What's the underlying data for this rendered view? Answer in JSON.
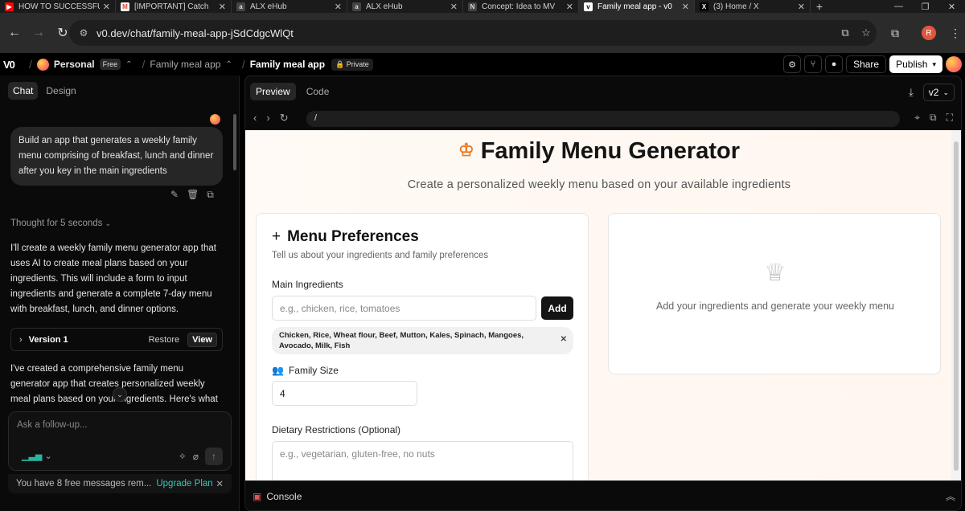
{
  "browser": {
    "tabs": [
      {
        "label": "HOW TO SUCCESSFU",
        "icon": "youtube-icon",
        "color": "#ff0000",
        "active": false
      },
      {
        "label": "[IMPORTANT] Catch",
        "icon": "gmail-icon",
        "color": "#ea4335",
        "active": false
      },
      {
        "label": "ALX eHub",
        "icon": "alx-icon",
        "color": "#555555",
        "active": false
      },
      {
        "label": "ALX eHub",
        "icon": "alx-icon",
        "color": "#555555",
        "active": false
      },
      {
        "label": "Concept: Idea to MV",
        "icon": "notion-icon",
        "color": "#555555",
        "active": false
      },
      {
        "label": "Family meal app - v0",
        "icon": "v0-icon",
        "color": "#ffffff",
        "active": true
      },
      {
        "label": "(3) Home / X",
        "icon": "x-icon",
        "color": "#ffffff",
        "active": false
      }
    ],
    "url": "v0.dev/chat/family-meal-app-jSdCdgcWlQt",
    "profile_initial": "R"
  },
  "app_header": {
    "logo": "V0",
    "workspace": "Personal",
    "plan_badge": "Free",
    "project_crumb": "Family meal app",
    "chat_title": "Family meal app",
    "privacy_badge": "Private",
    "share_label": "Share",
    "publish_label": "Publish"
  },
  "chat": {
    "tabs": [
      {
        "label": "Chat",
        "active": true
      },
      {
        "label": "Design",
        "active": false
      }
    ],
    "user_message": "Build an app that generates a weekly family menu comprising of breakfast, lunch and dinner after you key in the main ingredients",
    "thought": "Thought for 5 seconds",
    "ai_message_1": "I'll create a weekly family menu generator app that uses AI to create meal plans based on your ingredients. This will include a form to input ingredients and generate a complete 7-day menu with breakfast, lunch, and dinner options.",
    "version_card": {
      "name": "Version 1",
      "restore_label": "Restore",
      "view_label": "View"
    },
    "ai_message_2": "I've created a comprehensive family menu generator app that creates personalized weekly meal plans based on your ingredients. Here's what",
    "composer_placeholder": "Ask a follow-up...",
    "quota_text": "You have 8 free messages rem...",
    "upgrade_label": "Upgrade Plan"
  },
  "preview": {
    "tabs": [
      {
        "label": "Preview",
        "active": true
      },
      {
        "label": "Code",
        "active": false
      }
    ],
    "version": "v2",
    "path": "/",
    "console_label": "Console"
  },
  "menu_app": {
    "title": "Family Menu Generator",
    "subtitle": "Create a personalized weekly menu based on your available ingredients",
    "accent_color": "#ea7a24",
    "preferences": {
      "title": "Menu Preferences",
      "description": "Tell us about your ingredients and family preferences",
      "ingredients_label": "Main Ingredients",
      "ingredients_placeholder": "e.g., chicken, rice, tomatoes",
      "add_label": "Add",
      "ingredients_chip": "Chicken, Rice, Wheat flour, Beef, Mutton, Kales, Spinach, Mangoes, Avocado, Milk, Fish",
      "family_size_label": "Family Size",
      "family_size_value": "4",
      "dietary_label": "Dietary Restrictions (Optional)",
      "dietary_placeholder": "e.g., vegetarian, gluten-free, no nuts"
    },
    "empty_state": "Add your ingredients and generate your weekly menu"
  }
}
